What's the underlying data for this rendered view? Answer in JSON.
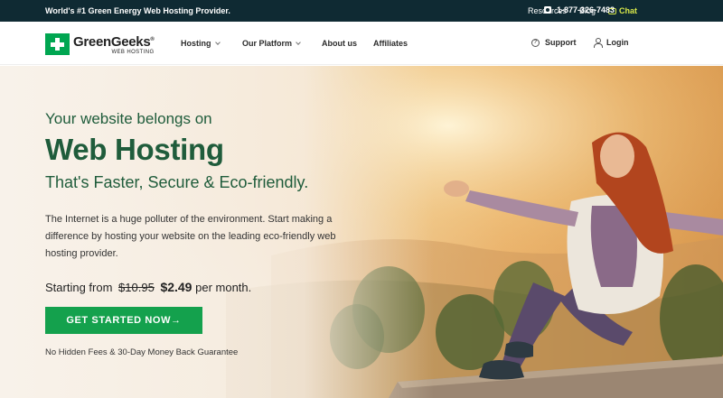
{
  "topbar": {
    "tagline": "World's #1 Green Energy Web Hosting Provider.",
    "resources": "Resources",
    "blog": "Blog",
    "chat": "Chat",
    "phone": "1-877-326-7483"
  },
  "nav": {
    "logo_main": "GreenGeeks",
    "logo_reg": "®",
    "logo_sub": "WEB HOSTING",
    "items": [
      {
        "label": "Hosting"
      },
      {
        "label": "Our Platform"
      },
      {
        "label": "About us"
      },
      {
        "label": "Affiliates"
      }
    ],
    "support": "Support",
    "login": "Login"
  },
  "hero": {
    "eyebrow": "Your website belongs on",
    "title": "Web Hosting",
    "subtitle": "That's Faster, Secure & Eco-friendly.",
    "description": "The Internet is a huge polluter of the environment. Start making a difference by hosting your website on the leading eco-friendly web hosting provider.",
    "price_prefix": "Starting from",
    "price_old": "$10.95",
    "price_new": "$2.49",
    "price_suffix": "per month.",
    "cta": "GET STARTED NOW→",
    "guarantee": "No Hidden Fees & 30-Day Money Back Guarantee"
  },
  "colors": {
    "topbar_bg": "#0f2a33",
    "brand_green": "#1f5c3b",
    "cta_green": "#14a14d",
    "chat_accent": "#d9e84a"
  }
}
